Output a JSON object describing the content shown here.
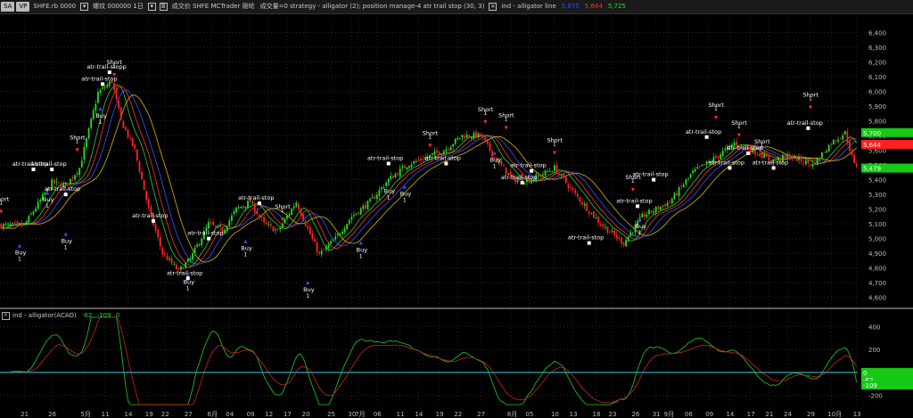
{
  "toolbar": {
    "sym_btn": "SA",
    "vp_btn": "VP",
    "symbol": "SHFE.rb 0000",
    "label1": "螺纹 000000  1日",
    "label2": "成交价  SHFE  MCTrader  刚纶",
    "strategy": "成交量=0  strategy - alligator (2); position manage-4  atr trail stop (30, 3)",
    "ind_name": "ind - alligator line",
    "ind_v1": "5,875",
    "ind_v2": "5,644",
    "ind_v3": "5,725"
  },
  "subpanel": {
    "name": "ind - alligator(ACAO)",
    "v1": "-62",
    "v2": "-109",
    "v3": "0"
  },
  "chart_data": [
    {
      "type": "candlestick",
      "title": "",
      "ylim": [
        4550,
        6500
      ],
      "yticks": [
        4600,
        4700,
        4800,
        4900,
        5000,
        5100,
        5200,
        5300,
        5400,
        5500,
        5600,
        5700,
        5800,
        5900,
        6000,
        6100,
        6200,
        6300,
        6400
      ],
      "ytick_labels": [
        "4,600",
        "4,700",
        "4,800",
        "4,900",
        "5,000",
        "5,100",
        "5,200",
        "5,300",
        "5,400",
        "5,500",
        "5,600",
        "5,700",
        "5,800",
        "5,900",
        "6,000",
        "6,100",
        "6,200",
        "6,300",
        "6,400"
      ],
      "n_bars": 260,
      "anchors": [
        [
          0,
          5090
        ],
        [
          10,
          5090
        ],
        [
          22,
          5380
        ],
        [
          28,
          5360
        ],
        [
          34,
          5480
        ],
        [
          42,
          5990
        ],
        [
          48,
          6070
        ],
        [
          52,
          5800
        ],
        [
          58,
          5600
        ],
        [
          64,
          5200
        ],
        [
          70,
          4900
        ],
        [
          77,
          4780
        ],
        [
          82,
          4860
        ],
        [
          90,
          5100
        ],
        [
          96,
          5050
        ],
        [
          102,
          5200
        ],
        [
          108,
          5250
        ],
        [
          114,
          5100
        ],
        [
          120,
          5050
        ],
        [
          128,
          5250
        ],
        [
          132,
          5100
        ],
        [
          138,
          4890
        ],
        [
          145,
          5000
        ],
        [
          152,
          5150
        ],
        [
          160,
          5250
        ],
        [
          168,
          5400
        ],
        [
          176,
          5500
        ],
        [
          184,
          5550
        ],
        [
          192,
          5600
        ],
        [
          200,
          5700
        ],
        [
          208,
          5700
        ],
        [
          214,
          5550
        ],
        [
          222,
          5400
        ],
        [
          230,
          5400
        ],
        [
          240,
          5480
        ],
        [
          250,
          5280
        ],
        [
          260,
          5100
        ],
        [
          270,
          4970
        ],
        [
          278,
          5150
        ],
        [
          290,
          5250
        ],
        [
          300,
          5450
        ],
        [
          310,
          5550
        ],
        [
          318,
          5650
        ],
        [
          326,
          5600
        ],
        [
          334,
          5530
        ],
        [
          342,
          5560
        ],
        [
          352,
          5500
        ],
        [
          360,
          5650
        ],
        [
          366,
          5720
        ],
        [
          370,
          5500
        ]
      ],
      "series": [
        {
          "name": "jaw",
          "color": "#3355ff",
          "lag": 8
        },
        {
          "name": "teeth",
          "color": "#ff3333",
          "lag": 5
        },
        {
          "name": "lips",
          "color": "#33cc33",
          "lag": 3
        },
        {
          "name": "line",
          "color": "#d9b300",
          "lag": 11
        }
      ],
      "price_labels": [
        {
          "text": "5,700",
          "color": "#17c917"
        },
        {
          "text": "5,644",
          "color": "#ff2020"
        },
        {
          "text": "5,479",
          "color": "#17c917"
        }
      ],
      "annotations": [
        {
          "text": "atr-trail-stopp",
          "type": "stop",
          "bar": 47,
          "price": 6130
        },
        {
          "text": "atr-trail-stop",
          "type": "stop",
          "bar": 44,
          "price": 6050
        },
        {
          "text": "Short",
          "type": "short",
          "bar": 49,
          "price": 6100
        },
        {
          "text": "atr-trail-stop",
          "type": "stop",
          "bar": 14,
          "price": 5470
        },
        {
          "text": "atr-trail-stop",
          "type": "stop",
          "bar": 22,
          "price": 5470
        },
        {
          "text": "Short",
          "type": "short",
          "bar": 33,
          "price": 5590
        },
        {
          "text": "Short",
          "type": "short",
          "bar": 0,
          "price": 5170
        },
        {
          "text": "Buy",
          "type": "buy",
          "bar": 8,
          "price": 5000
        },
        {
          "text": "Buy",
          "type": "buy",
          "bar": 20,
          "price": 5360
        },
        {
          "text": "atr-trail-stop",
          "type": "stop",
          "bar": 28,
          "price": 5300
        },
        {
          "text": "Buy",
          "type": "buy",
          "bar": 28,
          "price": 5080
        },
        {
          "text": "Buy",
          "type": "buy",
          "bar": 43,
          "price": 5930
        },
        {
          "text": "atr-trail-stop",
          "type": "stop",
          "bar": 66,
          "price": 5120
        },
        {
          "text": "atr-trail-stop",
          "type": "stop",
          "bar": 112,
          "price": 5240
        },
        {
          "text": "atr-trail-stop",
          "type": "stop",
          "bar": 90,
          "price": 5000
        },
        {
          "text": "Short",
          "type": "short",
          "bar": 122,
          "price": 5120
        },
        {
          "text": "Buy",
          "type": "buy",
          "bar": 81,
          "price": 4800
        },
        {
          "text": "atr-trail-stop",
          "type": "stop",
          "bar": 81,
          "price": 4730
        },
        {
          "text": "Buy",
          "type": "buy",
          "bar": 106,
          "price": 5030
        },
        {
          "text": "Buy",
          "type": "buy",
          "bar": 133,
          "price": 4750
        },
        {
          "text": "Buy",
          "type": "buy",
          "bar": 156,
          "price": 5020
        },
        {
          "text": "atr-trail-stop",
          "type": "stop",
          "bar": 168,
          "price": 5510
        },
        {
          "text": "Buy",
          "type": "buy",
          "bar": 175,
          "price": 5400
        },
        {
          "text": "Buy",
          "type": "buy",
          "bar": 168,
          "price": 5420
        },
        {
          "text": "Short",
          "type": "short",
          "bar": 186,
          "price": 5620
        },
        {
          "text": "Short",
          "type": "short",
          "bar": 210,
          "price": 5780
        },
        {
          "text": "Buy",
          "type": "buy",
          "bar": 214,
          "price": 5630
        },
        {
          "text": "atr-trail-stop",
          "type": "stop",
          "bar": 193,
          "price": 5510
        },
        {
          "text": "Short",
          "type": "short",
          "bar": 219,
          "price": 5740
        },
        {
          "text": "atr-trail-stop",
          "type": "stop",
          "bar": 230,
          "price": 5460
        },
        {
          "text": "atr-trail-stop",
          "type": "stop",
          "bar": 226,
          "price": 5380
        },
        {
          "text": "Short",
          "type": "short",
          "bar": 240,
          "price": 5570
        },
        {
          "text": "atr-trail-stop",
          "type": "stop",
          "bar": 255,
          "price": 4970
        },
        {
          "text": "Short",
          "type": "short",
          "bar": 274,
          "price": 5320
        },
        {
          "text": "Buy",
          "type": "buy",
          "bar": 277,
          "price": 5180
        },
        {
          "text": "atr-trail-stop",
          "type": "stop",
          "bar": 276,
          "price": 5220
        },
        {
          "text": "atr-trail-stop",
          "type": "stop",
          "bar": 283,
          "price": 5400
        },
        {
          "text": "atr-trail-stop",
          "type": "stop",
          "bar": 306,
          "price": 5690
        },
        {
          "text": "Short",
          "type": "short",
          "bar": 310,
          "price": 5810
        },
        {
          "text": "Short",
          "type": "short",
          "bar": 320,
          "price": 5690
        },
        {
          "text": "atr-trail-stop",
          "type": "stop",
          "bar": 316,
          "price": 5480
        },
        {
          "text": "atr-trail-stop",
          "type": "stop",
          "bar": 324,
          "price": 5580
        },
        {
          "text": "Short",
          "type": "short",
          "bar": 330,
          "price": 5560
        },
        {
          "text": "atr-trail-stop",
          "type": "stop",
          "bar": 335,
          "price": 5480
        },
        {
          "text": "atr-trail-stop",
          "type": "stop",
          "bar": 350,
          "price": 5750
        },
        {
          "text": "Short",
          "type": "short",
          "bar": 351,
          "price": 5880
        }
      ]
    },
    {
      "type": "line",
      "title": "",
      "ylim": [
        -280,
        480
      ],
      "yticks": [
        -200,
        0,
        200,
        400
      ],
      "ytick_labels": [
        "-200",
        "0",
        "200",
        "400"
      ],
      "price_labels": [
        {
          "text": "0",
          "color": "#17c917"
        },
        {
          "text": "-62",
          "color": "#17c917"
        },
        {
          "text": "-109",
          "color": "#17c917"
        }
      ],
      "series": [
        {
          "name": "ACAO-green",
          "color": "#22cc22"
        },
        {
          "name": "ACAO-red",
          "color": "#cc2222"
        },
        {
          "name": "zero",
          "color": "#2aa6aa"
        }
      ]
    }
  ],
  "xaxis": {
    "ticks": [
      {
        "label": "21",
        "bar": 10
      },
      {
        "label": "26",
        "bar": 22
      },
      {
        "label": "5月",
        "bar": 36
      },
      {
        "label": "11",
        "bar": 45
      },
      {
        "label": "14",
        "bar": 55
      },
      {
        "label": "19",
        "bar": 64
      },
      {
        "label": "22",
        "bar": 71
      },
      {
        "label": "27",
        "bar": 81
      },
      {
        "label": "6月",
        "bar": 91
      },
      {
        "label": "04",
        "bar": 99
      },
      {
        "label": "09",
        "bar": 108
      },
      {
        "label": "12",
        "bar": 116
      },
      {
        "label": "17",
        "bar": 124
      },
      {
        "label": "20",
        "bar": 132
      },
      {
        "label": "25",
        "bar": 143
      },
      {
        "label": "30",
        "bar": 152
      },
      {
        "label": "7月",
        "bar": 155
      },
      {
        "label": "06",
        "bar": 163
      },
      {
        "label": "11",
        "bar": 173
      },
      {
        "label": "14",
        "bar": 181
      },
      {
        "label": "19",
        "bar": 190
      },
      {
        "label": "22",
        "bar": 198
      },
      {
        "label": "27",
        "bar": 208
      },
      {
        "label": "8月",
        "bar": 221
      },
      {
        "label": "05",
        "bar": 229
      },
      {
        "label": "10",
        "bar": 240
      },
      {
        "label": "13",
        "bar": 248
      },
      {
        "label": "18",
        "bar": 258
      },
      {
        "label": "23",
        "bar": 265
      },
      {
        "label": "26",
        "bar": 275
      },
      {
        "label": "31",
        "bar": 284
      },
      {
        "label": "9月",
        "bar": 289
      },
      {
        "label": "06",
        "bar": 298
      },
      {
        "label": "09",
        "bar": 307
      },
      {
        "label": "14",
        "bar": 316
      },
      {
        "label": "17",
        "bar": 325
      },
      {
        "label": "21",
        "bar": 333
      },
      {
        "label": "24",
        "bar": 341
      },
      {
        "label": "29",
        "bar": 351
      },
      {
        "label": "10月",
        "bar": 360
      },
      {
        "label": "13",
        "bar": 371
      }
    ]
  }
}
